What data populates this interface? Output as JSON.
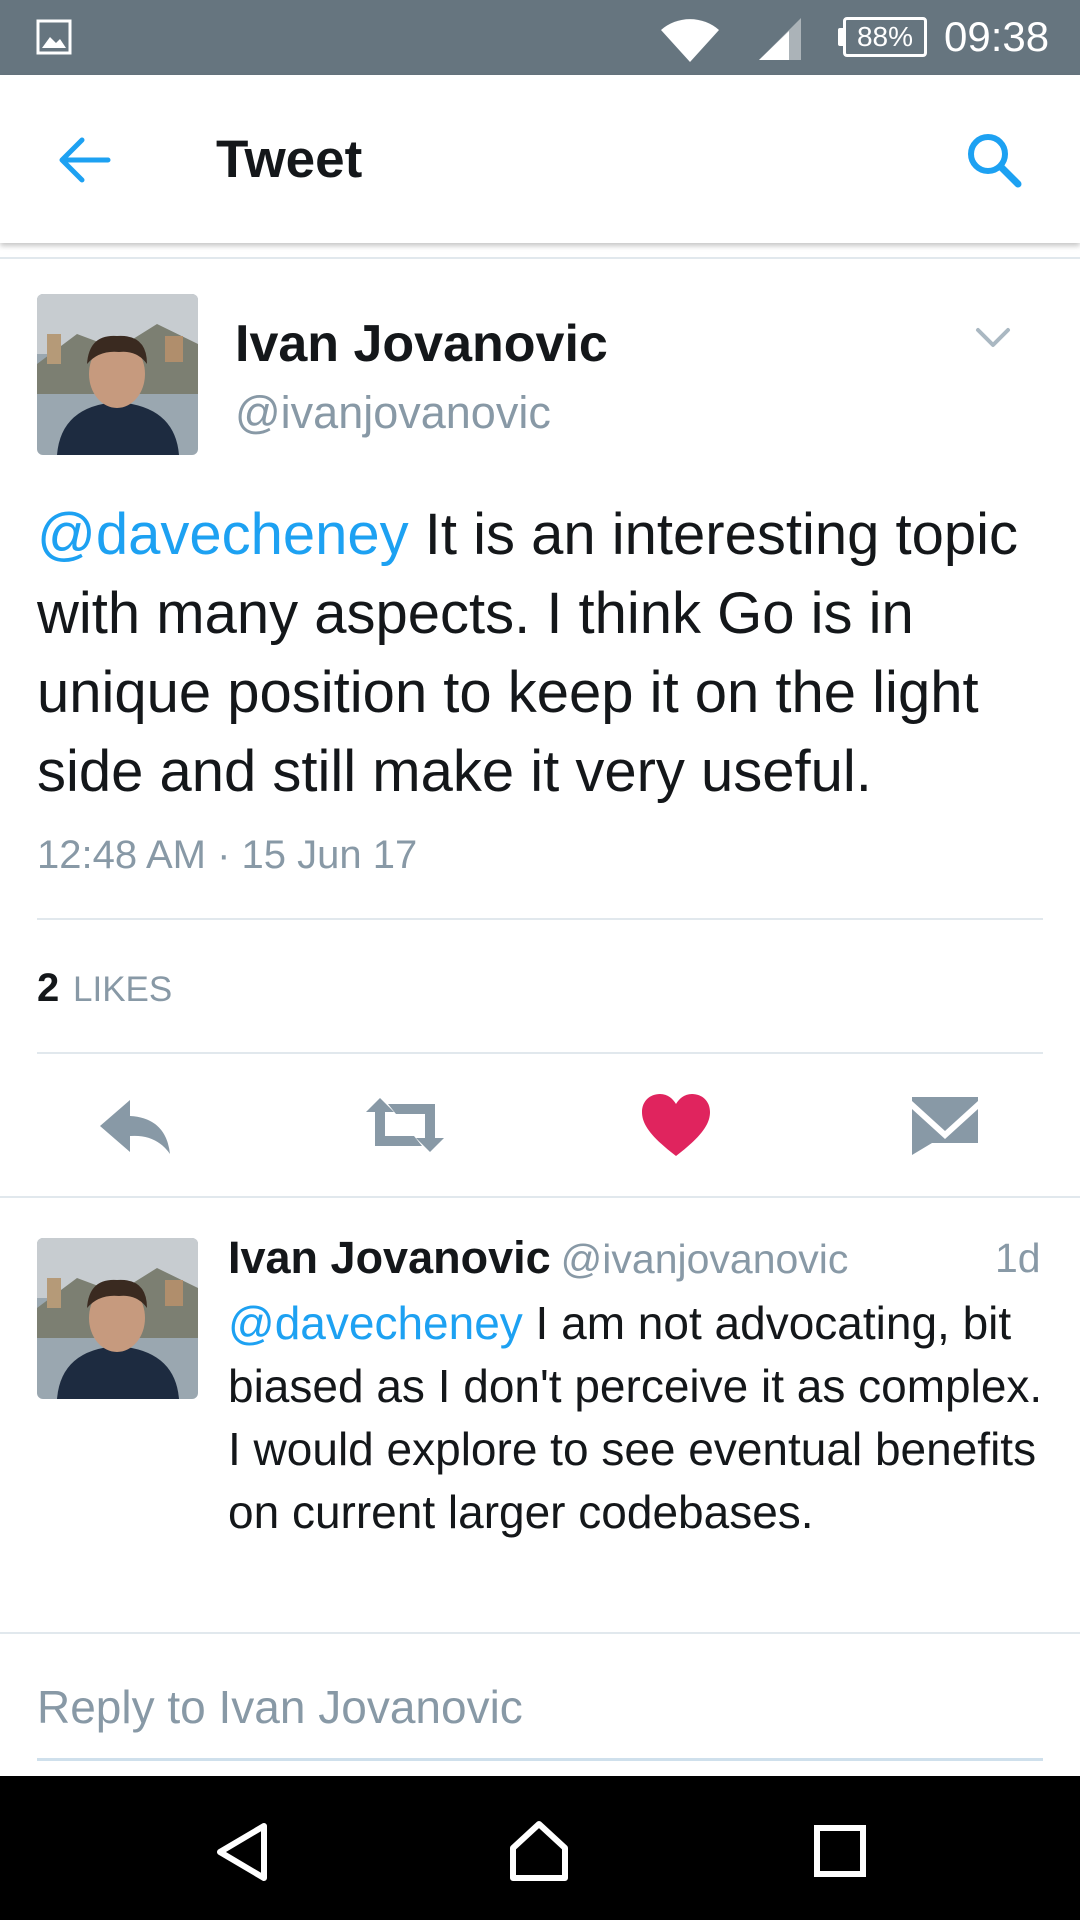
{
  "status_bar": {
    "battery": "88%",
    "time": "09:38",
    "icons": [
      "gallery-icon",
      "wifi-icon",
      "signal-icon",
      "battery-icon"
    ]
  },
  "toolbar": {
    "title": "Tweet",
    "back_icon": "back-arrow-icon",
    "search_icon": "search-icon"
  },
  "tweet": {
    "name": "Ivan Jovanovic",
    "handle": "@ivanjovanovic",
    "mention": "@davecheney",
    "text": " It is an interesting topic with many aspects. I think Go is in unique position to keep it on the light side and still make it very useful.",
    "timestamp": "12:48 AM · 15 Jun 17",
    "likes_count": "2",
    "likes_label": "LIKES",
    "actions": [
      "reply-icon",
      "retweet-icon",
      "like-icon",
      "direct-message-icon"
    ],
    "like_color": "#e0245e"
  },
  "reply": {
    "name": "Ivan Jovanovic",
    "handle": "@ivanjovanovic",
    "age": "1d",
    "mention": "@davecheney",
    "text": " I am not advocating, bit biased as I don't perceive it as complex. I would explore to see eventual benefits on current larger codebases."
  },
  "compose": {
    "placeholder": "Reply to Ivan Jovanovic"
  },
  "colors": {
    "accent": "#1da1f2",
    "status_bar": "#66757f",
    "secondary_text": "#8899a6"
  }
}
